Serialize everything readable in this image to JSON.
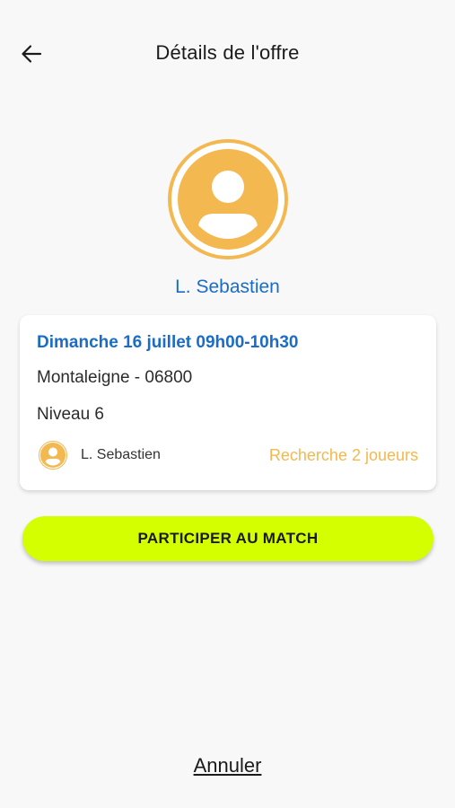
{
  "header": {
    "title": "Détails de l'offre",
    "back_icon": "arrow-left-icon"
  },
  "profile": {
    "avatar_icon": "user-avatar-icon",
    "name": "L. Sebastien"
  },
  "offer_card": {
    "date_time": "Dimanche 16 juillet 09h00-10h30",
    "location": "Montaleigne - 06800",
    "level": "Niveau 6",
    "organizer_name": "L. Sebastien",
    "search_status": "Recherche 2 joueurs"
  },
  "actions": {
    "participate_label": "PARTICIPER AU MATCH",
    "cancel_label": "Annuler"
  },
  "colors": {
    "accent_blue": "#1a6cc6",
    "avatar_orange": "#f3b84f",
    "cta_lime": "#d4ff00",
    "background": "#f8f8f8"
  }
}
